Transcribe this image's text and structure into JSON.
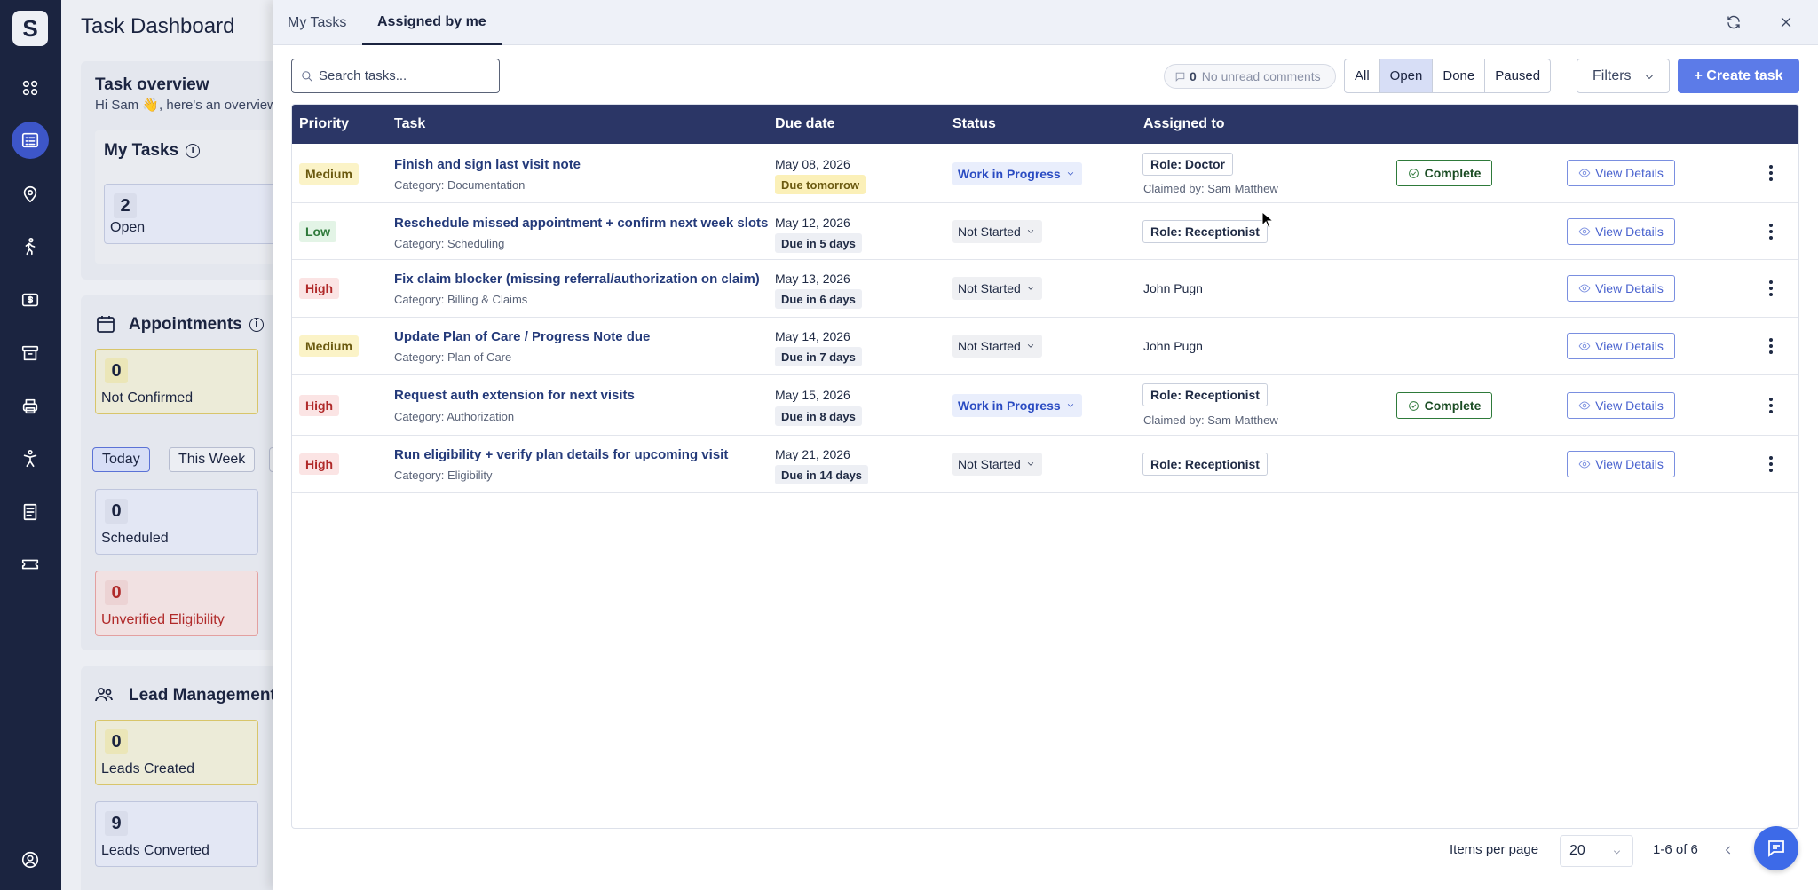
{
  "rail": {
    "logo": "S",
    "icons": [
      "dashboard-icon",
      "tasks-icon",
      "location-icon",
      "activity-icon",
      "billing-icon",
      "archive-icon",
      "printer-icon",
      "accessibility-icon",
      "document-icon",
      "ticket-icon",
      "user-icon"
    ]
  },
  "background": {
    "title": "Task Dashboard",
    "task_overview": {
      "title": "Task overview",
      "subtitle": "Hi Sam 👋, here's an overview"
    },
    "my_tasks": {
      "title": "My Tasks",
      "count": "2",
      "label": "Open"
    },
    "appointments": {
      "title": "Appointments",
      "not_confirmed": {
        "count": "0",
        "label": "Not Confirmed"
      },
      "filters": [
        "Today",
        "This Week"
      ],
      "scheduled": {
        "count": "0",
        "label": "Scheduled"
      },
      "unverified": {
        "count": "0",
        "label": "Unverified Eligibility"
      }
    },
    "leads": {
      "title": "Lead Management",
      "created": {
        "count": "0",
        "label": "Leads Created"
      },
      "converted": {
        "count": "9",
        "label": "Leads Converted"
      }
    }
  },
  "drawer": {
    "tabs": [
      "My Tasks",
      "Assigned by me"
    ],
    "active_tab": "Assigned by me",
    "search_placeholder": "Search tasks...",
    "unread": {
      "count": "0",
      "label": "No unread comments"
    },
    "segments": [
      "All",
      "Open",
      "Done",
      "Paused"
    ],
    "active_segment": "Open",
    "filters_label": "Filters",
    "create_label": "+ Create task",
    "columns": [
      "Priority",
      "Task",
      "Due date",
      "Status",
      "Assigned to"
    ],
    "rows": [
      {
        "priority": "Medium",
        "task": "Finish and sign last visit note",
        "category": "Category: Documentation",
        "date": "May 08, 2026",
        "due": "Due tomorrow",
        "status": "Work in Progress",
        "assigned": "Role: Doctor",
        "claimed": "Claimed by: Sam Matthew",
        "complete": "Complete",
        "view": "View Details"
      },
      {
        "priority": "Low",
        "task": "Reschedule missed appointment + confirm next week slots",
        "category": "Category: Scheduling",
        "date": "May 12, 2026",
        "due": "Due in 5 days",
        "status": "Not Started",
        "assigned": "Role: Receptionist",
        "view": "View Details"
      },
      {
        "priority": "High",
        "task": "Fix claim blocker (missing referral/authorization on claim)",
        "category": "Category: Billing & Claims",
        "date": "May 13, 2026",
        "due": "Due in 6 days",
        "status": "Not Started",
        "person": "John Pugn",
        "view": "View Details"
      },
      {
        "priority": "Medium",
        "task": "Update Plan of Care / Progress Note due",
        "category": "Category: Plan of Care",
        "date": "May 14, 2026",
        "due": "Due in 7 days",
        "status": "Not Started",
        "person": "John Pugn",
        "view": "View Details"
      },
      {
        "priority": "High",
        "task": "Request auth extension for next visits",
        "category": "Category: Authorization",
        "date": "May 15, 2026",
        "due": "Due in 8 days",
        "status": "Work in Progress",
        "assigned": "Role: Receptionist",
        "claimed": "Claimed by: Sam Matthew",
        "complete": "Complete",
        "view": "View Details"
      },
      {
        "priority": "High",
        "task": "Run eligibility + verify plan details for upcoming visit",
        "category": "Category: Eligibility",
        "date": "May 21, 2026",
        "due": "Due in 14 days",
        "status": "Not Started",
        "assigned": "Role: Receptionist",
        "view": "View Details"
      }
    ],
    "footer": {
      "items_per_page_label": "Items per page",
      "items_per_page": "20",
      "range": "1-6 of 6"
    }
  }
}
